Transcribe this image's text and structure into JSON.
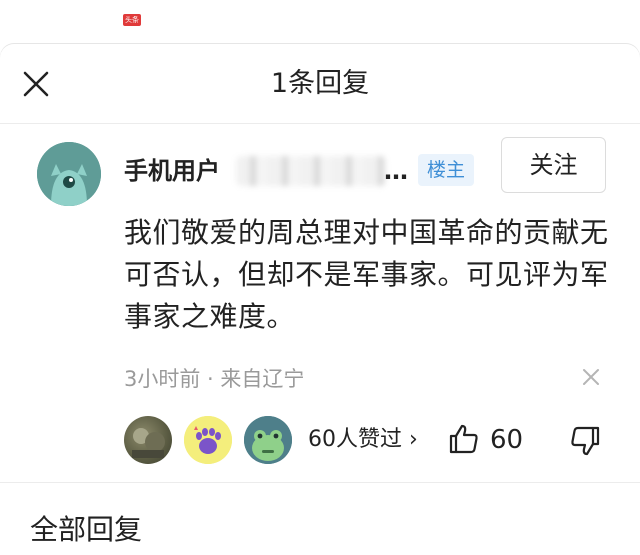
{
  "status_bar": {
    "app_badge": "头条"
  },
  "header": {
    "title": "1条回复",
    "close_icon": "close-icon"
  },
  "comment": {
    "user_name_visible": "手机用户",
    "ellipsis": "…",
    "owner_badge": "楼主",
    "follow_label": "关注",
    "text": "我们敬爱的周总理对中国革命的贡献无可否认，但却不是军事家。可见评为军事家之难度。",
    "meta": "3小时前 · 来自辽宁",
    "likers_summary": "60人赞过 ›",
    "like_count": "60"
  },
  "section": {
    "all_replies_label": "全部回复"
  },
  "colors": {
    "accent_blue": "#3f8fd6",
    "badge_bg": "#eaf3fc",
    "avatar_teal": "#5f9c97",
    "meta_gray": "#9a9a9a"
  }
}
